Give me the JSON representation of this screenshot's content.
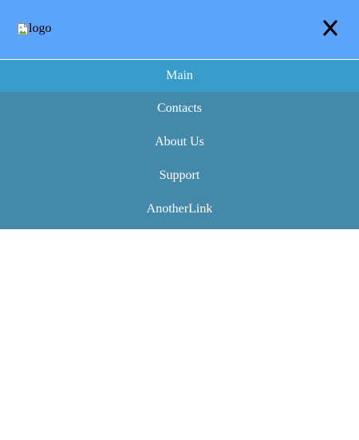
{
  "header": {
    "logo_alt": "logo",
    "close_icon": "close-icon",
    "colors": {
      "header_bg": "#5ba3fb",
      "close_color": "#000000"
    }
  },
  "nav": {
    "items": [
      {
        "label": "Main",
        "active": true
      },
      {
        "label": "Contacts",
        "active": false
      },
      {
        "label": "About Us",
        "active": false
      },
      {
        "label": "Support",
        "active": false
      },
      {
        "label": "AnotherLink",
        "active": false
      }
    ],
    "colors": {
      "menu_bg": "#4489aa",
      "active_bg": "#379cc8",
      "text": "#ffffff"
    }
  }
}
